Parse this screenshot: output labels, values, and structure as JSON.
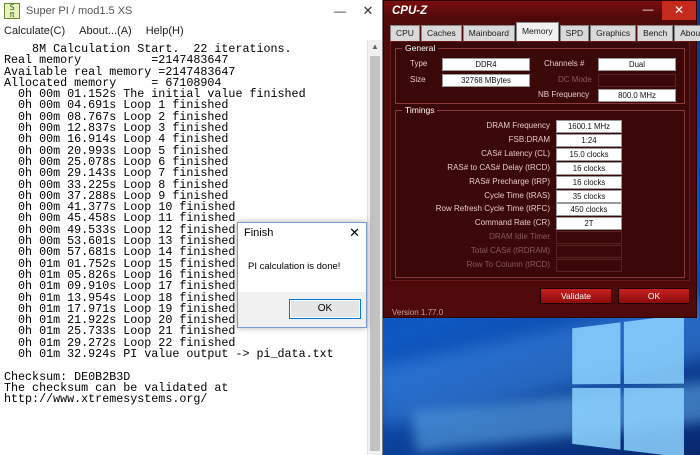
{
  "superpi": {
    "title": "Super PI / mod1.5 XS",
    "icon_text": "SUPER\nπ",
    "menu": [
      "Calculate(C)",
      "About...(A)",
      "Help(H)"
    ],
    "output_lines": [
      "    8M Calculation Start.  22 iterations.",
      "Real memory          =2147483647",
      "Available real memory =2147483647",
      "Allocated memory     = 67108904",
      "  0h 00m 01.152s The initial value finished",
      "  0h 00m 04.691s Loop 1 finished",
      "  0h 00m 08.767s Loop 2 finished",
      "  0h 00m 12.837s Loop 3 finished",
      "  0h 00m 16.914s Loop 4 finished",
      "  0h 00m 20.993s Loop 5 finished",
      "  0h 00m 25.078s Loop 6 finished",
      "  0h 00m 29.143s Loop 7 finished",
      "  0h 00m 33.225s Loop 8 finished",
      "  0h 00m 37.288s Loop 9 finished",
      "  0h 00m 41.377s Loop 10 finished",
      "  0h 00m 45.458s Loop 11 finished",
      "  0h 00m 49.533s Loop 12 finished",
      "  0h 00m 53.601s Loop 13 finished",
      "  0h 00m 57.681s Loop 14 finished",
      "  0h 01m 01.752s Loop 15 finished",
      "  0h 01m 05.826s Loop 16 finished",
      "  0h 01m 09.910s Loop 17 finished",
      "  0h 01m 13.954s Loop 18 finished",
      "  0h 01m 17.971s Loop 19 finished",
      "  0h 01m 21.922s Loop 20 finished",
      "  0h 01m 25.733s Loop 21 finished",
      "  0h 01m 29.272s Loop 22 finished",
      "  0h 01m 32.924s PI value output -> pi_data.txt",
      "",
      "Checksum: DE0B2B3D",
      "The checksum can be validated at",
      "http://www.xtremesystems.org/"
    ]
  },
  "dialog": {
    "title": "Finish",
    "message": "PI calculation is done!",
    "ok_label": "OK"
  },
  "cpuz": {
    "title": "CPU-Z",
    "tabs": [
      "CPU",
      "Caches",
      "Mainboard",
      "Memory",
      "SPD",
      "Graphics",
      "Bench",
      "About"
    ],
    "active_tab": "Memory",
    "general": {
      "legend": "General",
      "type_label": "Type",
      "type_value": "DDR4",
      "size_label": "Size",
      "size_value": "32768 MBytes",
      "channels_label": "Channels #",
      "channels_value": "Dual",
      "dc_mode_label": "DC Mode",
      "dc_mode_value": "",
      "nb_freq_label": "NB Frequency",
      "nb_freq_value": "800.0 MHz"
    },
    "timings": {
      "legend": "Timings",
      "rows": [
        {
          "label": "DRAM Frequency",
          "value": "1600.1 MHz",
          "dim": false
        },
        {
          "label": "FSB:DRAM",
          "value": "1:24",
          "dim": false
        },
        {
          "label": "CAS# Latency (CL)",
          "value": "15.0 clocks",
          "dim": false
        },
        {
          "label": "RAS# to CAS# Delay (tRCD)",
          "value": "16 clocks",
          "dim": false
        },
        {
          "label": "RAS# Precharge (tRP)",
          "value": "16 clocks",
          "dim": false
        },
        {
          "label": "Cycle Time (tRAS)",
          "value": "35 clocks",
          "dim": false
        },
        {
          "label": "Row Refresh Cycle Time (tRFC)",
          "value": "450 clocks",
          "dim": false
        },
        {
          "label": "Command Rate (CR)",
          "value": "2T",
          "dim": false
        },
        {
          "label": "DRAM Idle Timer",
          "value": "",
          "dim": true
        },
        {
          "label": "Total CAS# (tRDRAM)",
          "value": "",
          "dim": true
        },
        {
          "label": "Row To Column (tRCD)",
          "value": "",
          "dim": true
        }
      ]
    },
    "validate_label": "Validate",
    "ok_label": "OK",
    "version": "Version 1.77.0"
  },
  "colors": {
    "cpuz_bg": "#4e0a0a",
    "close_red": "#c42b1c",
    "desktop_blue": "#0d47a6"
  }
}
